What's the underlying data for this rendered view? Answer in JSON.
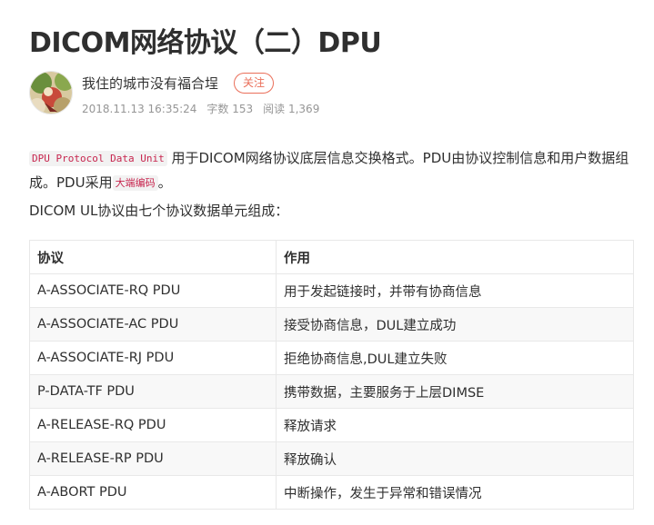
{
  "article": {
    "title": "DICOM网络协议（二）DPU",
    "author": "我住的城市没有福合埕",
    "follow_label": "关注",
    "date": "2018.11.13 16:35:24",
    "word_count": "字数 153",
    "read_count": "阅读 1,369"
  },
  "body": {
    "p1_code": "DPU Protocol Data Unit",
    "p1_text": "用于DICOM网络协议底层信息交换格式。PDU由协议控制信息和用户数据组成。PDU采用",
    "p1_code2": "大端编码",
    "p1_end": "。",
    "p2_text": "DICOM UL协议由七个协议数据单元组成："
  },
  "table": {
    "headers": [
      "协议",
      "作用"
    ],
    "rows": [
      [
        "A-ASSOCIATE-RQ PDU",
        "用于发起链接时，并带有协商信息"
      ],
      [
        "A-ASSOCIATE-AC PDU",
        "接受协商信息，DUL建立成功"
      ],
      [
        "A-ASSOCIATE-RJ PDU",
        "拒绝协商信息,DUL建立失败"
      ],
      [
        "P-DATA-TF PDU",
        "携带数据，主要服务于上层DIMSE"
      ],
      [
        "A-RELEASE-RQ PDU",
        "释放请求"
      ],
      [
        "A-RELEASE-RP PDU",
        "释放确认"
      ],
      [
        "A-ABORT PDU",
        "中断操作，发生于异常和错误情况"
      ]
    ]
  },
  "colors": {
    "accent": "#ea6f5a",
    "code_text": "#c7254e",
    "code_bg": "#f2f2f2",
    "meta_text": "#969696",
    "table_border": "#e8e8e8",
    "table_stripe": "#f8f8f8"
  }
}
